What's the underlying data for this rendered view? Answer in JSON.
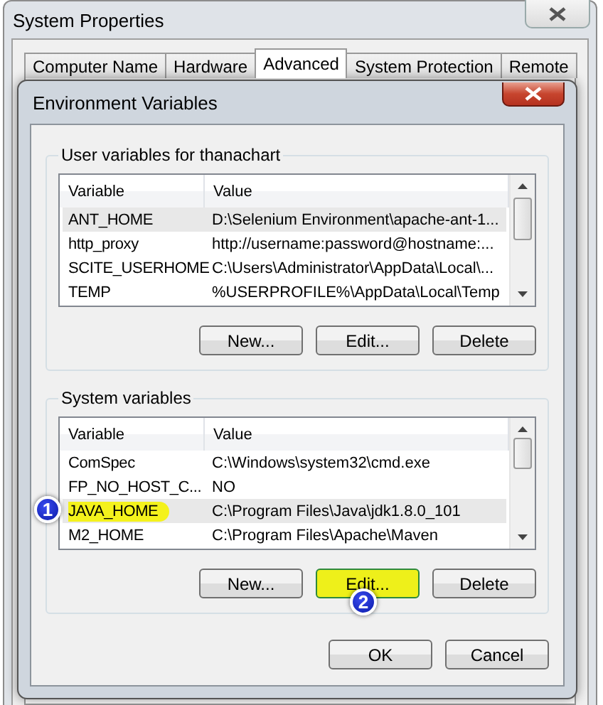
{
  "window": {
    "title": "System Properties"
  },
  "tabs": [
    {
      "label": "Computer Name",
      "selected": false
    },
    {
      "label": "Hardware",
      "selected": false
    },
    {
      "label": "Advanced",
      "selected": true
    },
    {
      "label": "System Protection",
      "selected": false
    },
    {
      "label": "Remote",
      "selected": false
    }
  ],
  "dialog": {
    "title": "Environment Variables",
    "user_variables": {
      "title": "User variables for thanachart",
      "columns": [
        "Variable",
        "Value"
      ],
      "rows": [
        {
          "name": "ANT_HOME",
          "value": "D:\\Selenium Environment\\apache-ant-1...",
          "selected": true,
          "highlighted": false
        },
        {
          "name": "http_proxy",
          "value": "http://username:password@hostname:...",
          "selected": false,
          "highlighted": false
        },
        {
          "name": "SCITE_USERHOME",
          "value": "C:\\Users\\Administrator\\AppData\\Local\\...",
          "selected": false,
          "highlighted": false
        },
        {
          "name": "TEMP",
          "value": "%USERPROFILE%\\AppData\\Local\\Temp",
          "selected": false,
          "highlighted": false
        }
      ],
      "buttons": [
        {
          "label": "New...",
          "highlighted": false
        },
        {
          "label": "Edit...",
          "highlighted": false
        },
        {
          "label": "Delete",
          "highlighted": false
        }
      ]
    },
    "system_variables": {
      "title": "System variables",
      "columns": [
        "Variable",
        "Value"
      ],
      "rows": [
        {
          "name": "ComSpec",
          "value": "C:\\Windows\\system32\\cmd.exe",
          "selected": false,
          "highlighted": false
        },
        {
          "name": "FP_NO_HOST_C...",
          "value": "NO",
          "selected": false,
          "highlighted": false
        },
        {
          "name": "JAVA_HOME",
          "value": "C:\\Program Files\\Java\\jdk1.8.0_101",
          "selected": true,
          "highlighted": true,
          "badge": "1"
        },
        {
          "name": "M2_HOME",
          "value": "C:\\Program Files\\Apache\\Maven",
          "selected": false,
          "highlighted": false
        }
      ],
      "buttons": [
        {
          "label": "New...",
          "highlighted": false
        },
        {
          "label": "Edit...",
          "highlighted": true,
          "badge": "2"
        },
        {
          "label": "Delete",
          "highlighted": false
        }
      ]
    },
    "buttons": [
      {
        "label": "OK"
      },
      {
        "label": "Cancel"
      }
    ]
  }
}
